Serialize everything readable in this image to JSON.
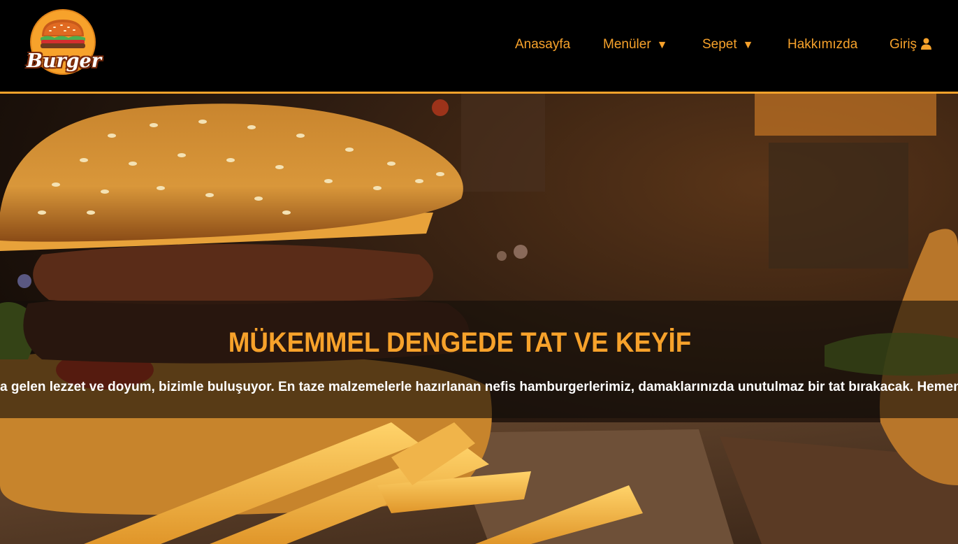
{
  "brand": {
    "logo_text": "Burger",
    "accent_color": "#f7a22b"
  },
  "nav": {
    "items": [
      {
        "label": "Anasayfa"
      },
      {
        "label": "Menüler",
        "caret": "▼"
      },
      {
        "label": "Sepet",
        "caret": "▼"
      },
      {
        "label": "Hakkımızda"
      },
      {
        "label": "Giriş",
        "icon": "user-icon"
      }
    ]
  },
  "hero": {
    "title": "MÜKEMMEL DENGEDE TAT VE KEYİF",
    "marquee_visible": "a gelen lezzet ve doyum, bizimle buluşuyor. En taze malzemelerle hazırlanan nefis hamburgerlerimiz, damaklarınızda unutulmaz bir tat bırakacak. Hemen sipariş verin, lezzetin d"
  }
}
